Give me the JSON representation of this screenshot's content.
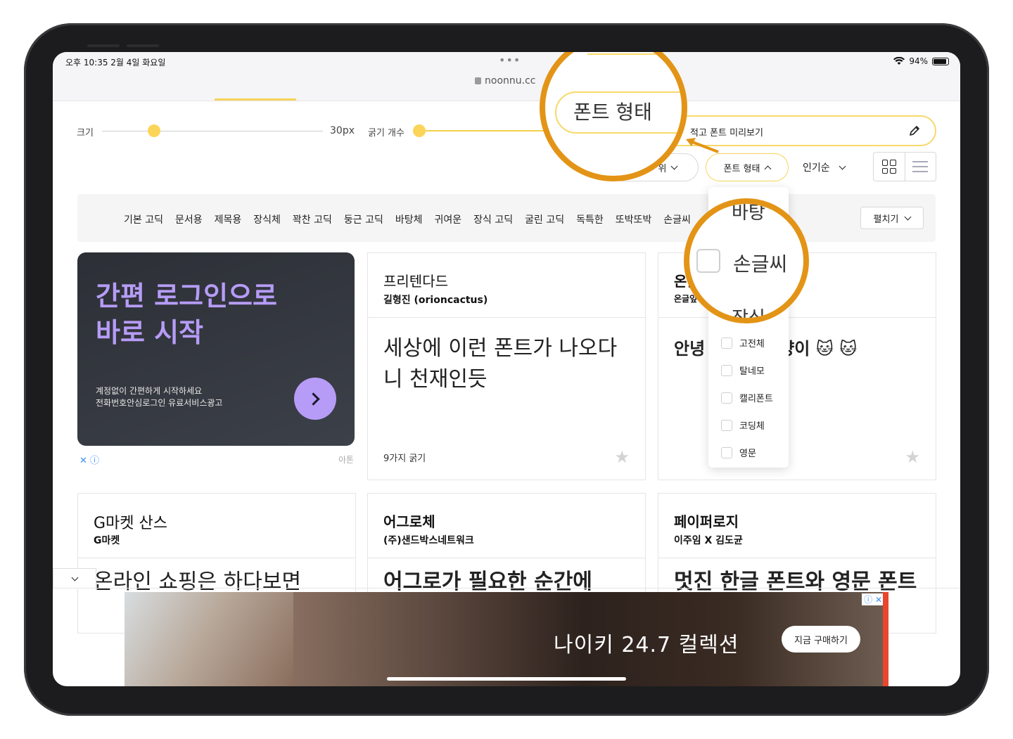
{
  "status": {
    "time": "오후 10:35  2월 4일 화요일",
    "url": "noonnu.cc",
    "battery": "94%"
  },
  "controls": {
    "size_label": "크기",
    "size_value": "30px",
    "weight_label": "굵기 개수",
    "preview_placeholder": "적고 폰트 미리보기",
    "filter_partial": "위",
    "font_type_label": "폰트 형태",
    "sort_label": "인기순"
  },
  "categories": [
    "기본 고딕",
    "문서용",
    "제목용",
    "장식체",
    "꽉찬 고딕",
    "둥근 고딕",
    "바탕체",
    "귀여운",
    "장식 고딕",
    "굴린 고딕",
    "독특한",
    "또박또박",
    "손글씨"
  ],
  "expand_label": "펼치기",
  "ad": {
    "headline_line1": "간편 로그인으로",
    "headline_line2": "바로 시작",
    "sub_line1": "계정없이 간편하게 시작하세요",
    "sub_line2": "전화번호안심로그인 유료서비스광고",
    "meta": "✕ ⓘ",
    "source": "아톤"
  },
  "cards": [
    {
      "name": "프리텐다드",
      "author": "길형진 (orioncactus)",
      "sample": "세상에 이런 폰트가 나오다니 천재인듯",
      "weights": "9가지 굵기"
    },
    {
      "name": "온글잎",
      "author": "온글잎",
      "sample": "안녕 소중한 고양이 🐱 🐱",
      "weights": ""
    },
    {
      "name": "G마켓 산스",
      "author": "G마켓",
      "sample": "온라인 쇼핑은 하다보면",
      "weights": ""
    },
    {
      "name": "어그로체",
      "author": "(주)샌드박스네트워크",
      "sample": "어그로가 필요한 순간에",
      "weights": ""
    },
    {
      "name": "페이퍼로지",
      "author": "이주임 X 김도균",
      "sample": "멋진 한글 폰트와 영문 폰트",
      "weights": ""
    }
  ],
  "dropdown": {
    "options": [
      "고전체",
      "탈네모",
      "캘리폰트",
      "코딩체",
      "영문"
    ]
  },
  "zoom1": {
    "label": "폰트 형태"
  },
  "zoom2": {
    "top": "바탕",
    "main": "손글씨",
    "bottom": "장식"
  },
  "banner": {
    "text": "나이키  24.7  컬렉션",
    "cta": "지금 구매하기",
    "adicons": "ⓘ ✕"
  },
  "colors": {
    "accent_yellow": "#fcd458",
    "zoom_orange": "#e39416",
    "ad_purple": "#b69cf7"
  }
}
